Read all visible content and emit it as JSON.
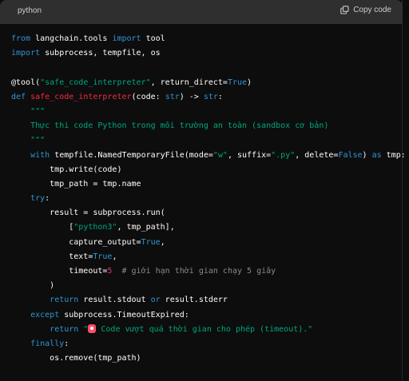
{
  "header": {
    "language": "python",
    "copy_label": "Copy code"
  },
  "code": {
    "l1": [
      "from",
      " langchain.tools ",
      "import",
      " tool"
    ],
    "l2": [
      "import",
      " subprocess, tempfile, os"
    ],
    "l4": [
      "@tool(",
      "\"safe_code_interpreter\"",
      ", return_direct=",
      "True",
      ")"
    ],
    "l5": [
      "def",
      " ",
      "safe_code_interpreter",
      "(code: ",
      "str",
      ") -> ",
      "str",
      ":"
    ],
    "l6": "    \"\"\"",
    "l7": "    Thực thi code Python trong môi trường an toàn (sandbox cơ bản)",
    "l8": "    \"\"\"",
    "l9": [
      "    ",
      "with",
      " tempfile.NamedTemporaryFile(mode=",
      "\"w\"",
      ", suffix=",
      "\".py\"",
      ", delete=",
      "False",
      ") ",
      "as",
      " tmp:"
    ],
    "l10": "        tmp.write(code)",
    "l11": "        tmp_path = tmp.name",
    "l12": [
      "    ",
      "try",
      ":"
    ],
    "l13": "        result = subprocess.run(",
    "l14": [
      "            [",
      "\"python3\"",
      ", tmp_path],"
    ],
    "l15": [
      "            capture_output=",
      "True",
      ","
    ],
    "l16": [
      "            text=",
      "True",
      ","
    ],
    "l17": [
      "            timeout=",
      "5",
      "  ",
      "# giới hạn thời gian chạy 5 giây"
    ],
    "l18": "        )",
    "l19": [
      "        ",
      "return",
      " result.stdout ",
      "or",
      " result.stderr"
    ],
    "l20": [
      "    ",
      "except",
      " subprocess.TimeoutExpired:"
    ],
    "l21": [
      "        ",
      "return",
      " ",
      "\"",
      " Code vượt quá thời gian cho phép (timeout).\""
    ],
    "l22": [
      "    ",
      "finally",
      ":"
    ],
    "l23": "        os.remove(tmp_path)"
  },
  "icons": {
    "copy": "copy-icon",
    "emoji": "alarm-clock-emoji"
  },
  "colors": {
    "background": "#0d0d0d",
    "header": "#2f2f2f",
    "keyword": "#2e95d3",
    "string": "#00a67d",
    "function_name": "#f22c3d",
    "number": "#df3079",
    "comment": "#8a8a8a"
  }
}
